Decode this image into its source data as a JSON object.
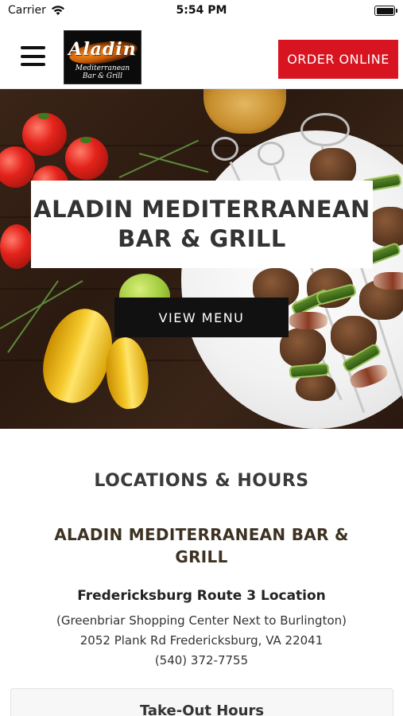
{
  "status_bar": {
    "carrier": "Carrier",
    "time": "5:54 PM",
    "icons": [
      "wifi-icon",
      "battery-icon"
    ]
  },
  "header": {
    "logo": {
      "name": "Aladin",
      "subtitle_line1": "Mediterranean",
      "subtitle_line2": "Bar & Grill"
    },
    "menu_icon": "hamburger-icon",
    "order_button_label": "ORDER ONLINE",
    "colors": {
      "order_button": "#d7141f"
    }
  },
  "hero": {
    "title_line1": "ALADIN MEDITERRANEAN",
    "title_line2": "BAR & GRILL",
    "view_menu_label": "VIEW MENU"
  },
  "locations": {
    "heading": "LOCATIONS & HOURS",
    "restaurant_name": "ALADIN MEDITERRANEAN BAR & GRILL",
    "location_title": "Fredericksburg Route 3 Location",
    "address_note": "(Greenbriar Shopping Center Next to Burlington)",
    "address": "2052 Plank Rd Fredericksburg, VA 22041",
    "phone": "(540) 372-7755",
    "hours_card_title": "Take-Out Hours"
  }
}
